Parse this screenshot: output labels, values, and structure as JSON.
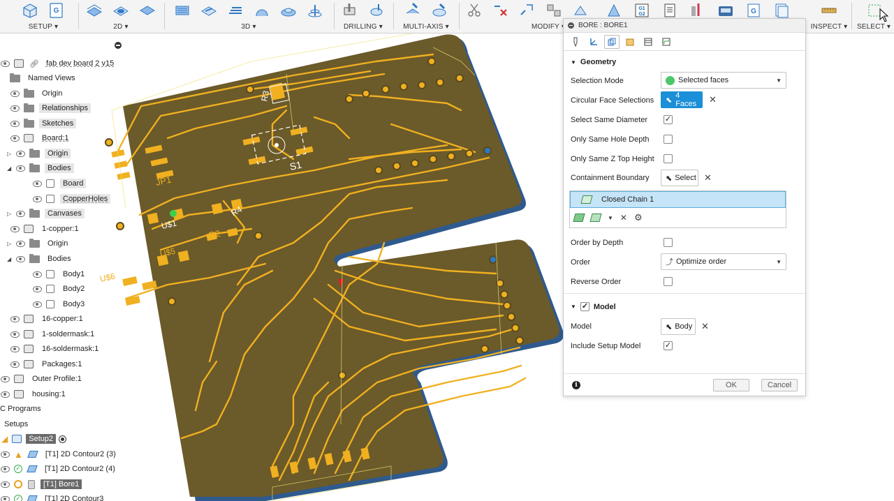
{
  "toolbar": {
    "groups": [
      {
        "label": "SETUP",
        "caret": "▾"
      },
      {
        "label": "2D",
        "caret": "▾"
      },
      {
        "label": "3D",
        "caret": "▾"
      },
      {
        "label": "DRILLING",
        "caret": "▾"
      },
      {
        "label": "MULTI-AXIS",
        "caret": "▾"
      },
      {
        "label": "MODIFY",
        "caret": "▾"
      },
      {
        "label": "INSPECT",
        "caret": "▾"
      },
      {
        "label": "SELECT",
        "caret": "▾"
      }
    ],
    "g_icon_text": "G",
    "g1g2_text": "G1\nG2"
  },
  "browser": {
    "doc_title": "fab dev board 2 v15",
    "rows": [
      {
        "label": "Named Views"
      },
      {
        "label": "Origin"
      },
      {
        "label": "Relationships"
      },
      {
        "label": "Sketches"
      },
      {
        "label": "Board:1"
      },
      {
        "label": "Origin"
      },
      {
        "label": "Bodies"
      },
      {
        "label": "Board"
      },
      {
        "label": "CopperHoles"
      },
      {
        "label": "Canvases"
      },
      {
        "label": "1-copper:1"
      },
      {
        "label": "Origin"
      },
      {
        "label": "Bodies"
      },
      {
        "label": "Body1"
      },
      {
        "label": "Body2"
      },
      {
        "label": "Body3"
      },
      {
        "label": "16-copper:1"
      },
      {
        "label": "1-soldermask:1"
      },
      {
        "label": "16-soldermask:1"
      },
      {
        "label": "Packages:1"
      },
      {
        "label": "Outer Profile:1"
      },
      {
        "label": "housing:1"
      },
      {
        "label": "C Programs"
      },
      {
        "label": "Setups"
      },
      {
        "label": "Setup2"
      },
      {
        "label": "[T1] 2D Contour2 (3)"
      },
      {
        "label": "[T1] 2D Contour2 (4)"
      },
      {
        "label": "[T1] Bore1"
      },
      {
        "label": "[T1] 2D Contour3"
      }
    ]
  },
  "pcb": {
    "labels": {
      "r3": "R3",
      "s1": "S1",
      "jp1": "JP1",
      "u1": "U$1",
      "r4": "R4",
      "r2": "R2",
      "u5": "U$5",
      "u6": "U$6"
    },
    "colors": {
      "board": "#6b5a2a",
      "trace": "#f0b020",
      "edge": "#3a5b8a"
    }
  },
  "dialog": {
    "title": "BORE : BORE1",
    "sections": {
      "geometry": "Geometry",
      "model": "Model"
    },
    "fields": {
      "selection_mode_label": "Selection Mode",
      "selection_mode_value": "Selected faces",
      "circular_face_label": "Circular Face Selections",
      "circular_face_value": "4 Faces",
      "same_diameter_label": "Select Same Diameter",
      "same_depth_label": "Only Same Hole Depth",
      "same_z_label": "Only Same Z Top Height",
      "containment_label": "Containment Boundary",
      "containment_value": "Select",
      "chain_item": "Closed Chain 1",
      "order_by_depth_label": "Order by Depth",
      "order_label": "Order",
      "order_value": "Optimize order",
      "reverse_order_label": "Reverse Order",
      "model_label": "Model",
      "model_value": "Body",
      "include_setup_label": "Include Setup Model"
    },
    "checks": {
      "same_diameter": true,
      "same_depth": false,
      "same_z": false,
      "order_by_depth": false,
      "reverse_order": false,
      "model_section": true,
      "include_setup": true
    },
    "buttons": {
      "ok": "OK",
      "cancel": "Cancel"
    },
    "info": "i",
    "accent": "#1b8fd8"
  }
}
